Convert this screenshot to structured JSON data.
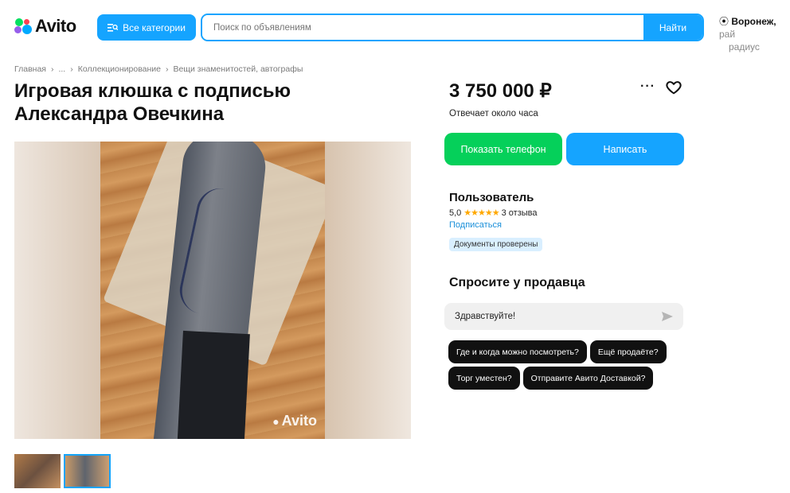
{
  "header": {
    "logo_text": "Avito",
    "categories_label": "Все категории",
    "search_placeholder": "Поиск по объявлениям",
    "search_button": "Найти",
    "location_city": "Воронеж,",
    "location_extra": "рай",
    "location_sub": "радиус"
  },
  "breadcrumb": [
    "Главная",
    "›",
    "...",
    "›",
    "Коллекционирование",
    "›",
    "Вещи знаменитостей, автографы"
  ],
  "listing": {
    "title": "Игровая клюшка с подписью Александра Овечкина",
    "watermark": "Avito",
    "thumbnails": 2,
    "selected_thumbnail": 2
  },
  "sidebar": {
    "price": "3 750 000 ₽",
    "more_icon": "more-dots-icon",
    "favorite_icon": "heart-icon",
    "responds": "Отвечает около часа",
    "show_phone": "Показать телефон",
    "write": "Написать",
    "seller": {
      "name": "Пользователь",
      "rating": "5,0",
      "stars": "★★★★★",
      "reviews": "3 отзыва",
      "subscribe": "Подписаться",
      "badge": "Документы проверены"
    },
    "ask": {
      "title": "Спросите у продавца",
      "input_value": "Здравствуйте!",
      "send_icon": "send-icon",
      "chips": [
        "Где и когда можно посмотреть?",
        "Ещё продаёте?",
        "Торг уместен?",
        "Отправите Авито Доставкой?"
      ]
    }
  },
  "colors": {
    "accent_blue": "#15a4ff",
    "accent_green": "#05d05a",
    "star": "#ffa800"
  }
}
